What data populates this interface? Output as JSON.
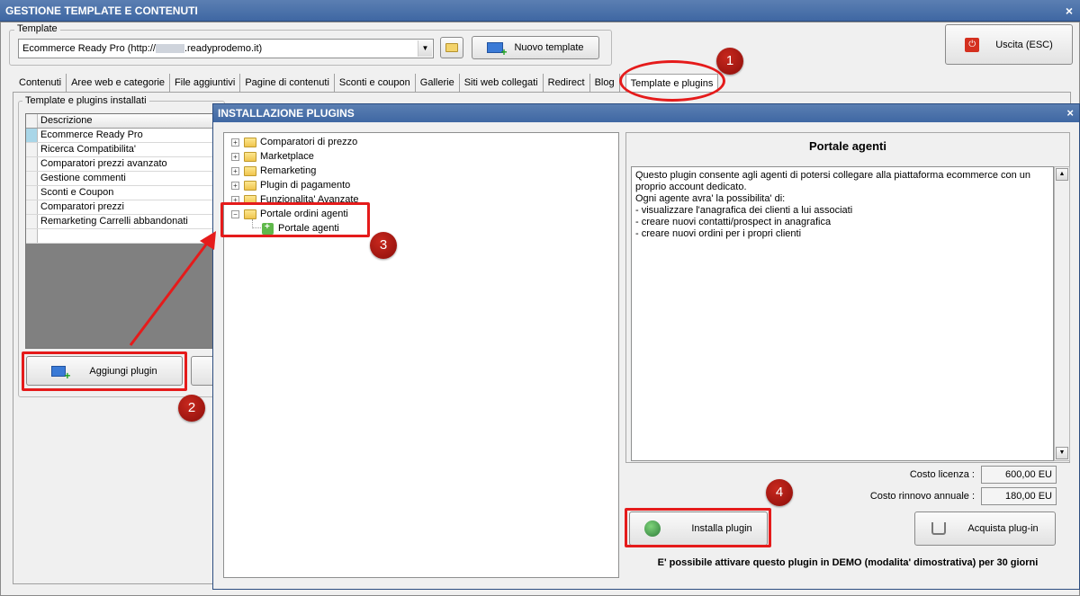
{
  "window": {
    "title": "GESTIONE TEMPLATE E CONTENUTI",
    "close": "×"
  },
  "template_group": {
    "label": "Template",
    "combo_value": "Ecommerce Ready Pro (http://",
    "combo_suffix": ".readyprodemo.it)",
    "new_template": "Nuovo template"
  },
  "exit_button": "Uscita (ESC)",
  "tabs": [
    "Contenuti",
    "Aree web e categorie",
    "File aggiuntivi",
    "Pagine di contenuti",
    "Sconti e coupon",
    "Gallerie",
    "Siti web collegati",
    "Redirect",
    "Blog",
    "Template e plugins"
  ],
  "installed_group": {
    "label": "Template e plugins installati",
    "header": "Descrizione",
    "rows": [
      "Ecommerce Ready Pro",
      "Ricerca Compatibilita'",
      "Comparatori prezzi avanzato",
      "Gestione commenti",
      "Sconti e Coupon",
      "Comparatori prezzi",
      "Remarketing Carrelli abbandonati",
      ""
    ],
    "add_plugin": "Aggiungi plugin"
  },
  "dialog": {
    "title": "INSTALLAZIONE PLUGINS",
    "close": "×",
    "tree": [
      {
        "label": "Comparatori di prezzo",
        "expander": "+"
      },
      {
        "label": "Marketplace",
        "expander": "+"
      },
      {
        "label": "Remarketing",
        "expander": "+"
      },
      {
        "label": "Plugin di pagamento",
        "expander": "+"
      },
      {
        "label": "Funzionalita' Avanzate",
        "expander": "+"
      },
      {
        "label": "Portale ordini agenti",
        "expander": "−"
      }
    ],
    "tree_child": "Portale agenti",
    "plugin_title": "Portale agenti",
    "description": "Questo plugin consente agli agenti di potersi collegare alla piattaforma ecommerce con un proprio account dedicato.\nOgni agente avra' la possibilita' di:\n- visualizzare l'anagrafica dei clienti a lui associati\n- creare nuovi contatti/prospect in anagrafica\n- creare nuovi ordini per i propri clienti",
    "license_label": "Costo licenza :",
    "license_value": "600,00 EU",
    "renewal_label": "Costo rinnovo annuale :",
    "renewal_value": "180,00 EU",
    "install": "Installa plugin",
    "buy": "Acquista plug-in",
    "demo_note": "E' possibile attivare questo plugin in DEMO (modalita' dimostrativa) per 30 giorni"
  },
  "callouts": [
    "1",
    "2",
    "3",
    "4"
  ],
  "colors": {
    "titlebar": "#4a70aa",
    "callout_red": "#e51b1b",
    "badge": "#a3140f"
  }
}
